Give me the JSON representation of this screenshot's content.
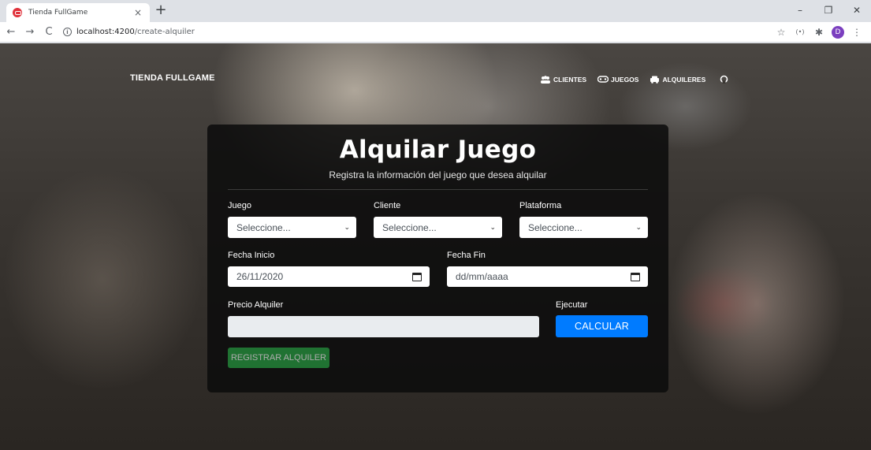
{
  "browser": {
    "tab_title": "Tienda FullGame",
    "tab_close": "×",
    "new_tab": "+",
    "url_host": "localhost:4200",
    "url_path": "/create-alquiler",
    "profile_initial": "D",
    "minimize": "–",
    "maximize": "❐",
    "close": "✕",
    "back": "←",
    "forward": "→",
    "reload": "C",
    "star": "☆",
    "ext": "(•)",
    "puzzle": "✱"
  },
  "navbar": {
    "brand": "TIENDA FULLGAME",
    "items": [
      {
        "label": "CLIENTES",
        "icon": "users-icon"
      },
      {
        "label": "JUEGOS",
        "icon": "gamepad-icon"
      },
      {
        "label": "ALQUILERES",
        "icon": "car-icon"
      }
    ],
    "github_icon": "github-icon"
  },
  "form": {
    "title": "Alquilar Juego",
    "subtitle": "Registra la información del juego que desea alquilar",
    "juego": {
      "label": "Juego",
      "value": "Seleccione..."
    },
    "cliente": {
      "label": "Cliente",
      "value": "Seleccione..."
    },
    "plataforma": {
      "label": "Plataforma",
      "value": "Seleccione..."
    },
    "fecha_inicio": {
      "label": "Fecha Inicio",
      "value": "26/11/2020"
    },
    "fecha_fin": {
      "label": "Fecha Fin",
      "value": "dd/mm/aaaa"
    },
    "precio": {
      "label": "Precio Alquiler",
      "value": ""
    },
    "ejecutar": {
      "label": "Ejecutar",
      "button": "CALCULAR"
    },
    "registrar": "REGISTRAR ALQUILER"
  },
  "colors": {
    "primary": "#007bff",
    "success": "#28a745",
    "card_bg": "#0c0c0c"
  }
}
